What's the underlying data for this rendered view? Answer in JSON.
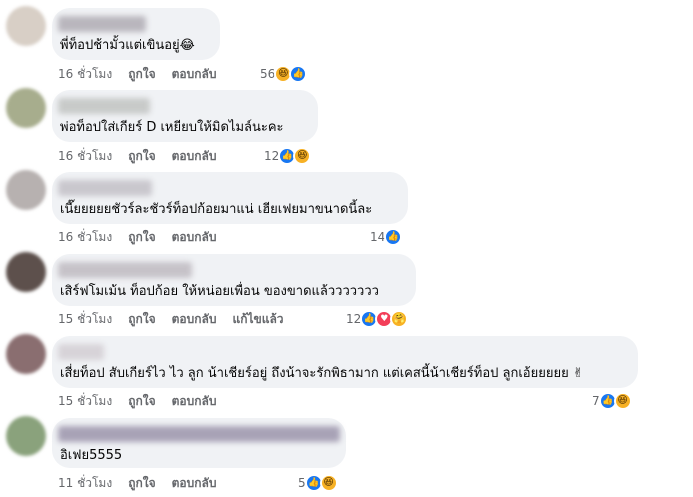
{
  "comments": [
    {
      "text": "พี่ท็อปช้ามั้วแต่เขินอยู่😂",
      "time": "16 ชั่วโมง",
      "like": "ถูกใจ",
      "reply": "ตอบกลับ",
      "edited": "",
      "count": "56",
      "reactions": [
        "haha",
        "like"
      ],
      "colors": {
        "avatar": "#d8cfc6",
        "name": "#b9b6bd"
      }
    },
    {
      "text": "พ่อท็อปใส่เกียร์ D เหยียบให้มิดไมล์นะคะ",
      "time": "16 ชั่วโมง",
      "like": "ถูกใจ",
      "reply": "ตอบกลับ",
      "edited": "",
      "count": "12",
      "reactions": [
        "like",
        "haha"
      ],
      "colors": {
        "avatar": "#a7ad8d",
        "name": "#c8cac9"
      }
    },
    {
      "text": "เนี๊ยยยยยชัวร์ละชัวร์ท็อปก้อยมาแน่ เฮียเฟยมาขนาดนี้ละ",
      "time": "16 ชั่วโมง",
      "like": "ถูกใจ",
      "reply": "ตอบกลับ",
      "edited": "",
      "count": "14",
      "reactions": [
        "like"
      ],
      "colors": {
        "avatar": "#b7b1b0",
        "name": "#c9c7cd"
      }
    },
    {
      "text": "เสิร์ฟโมเม้น ท็อปก้อย ให้หน่อยเพื่อน ของขาดแล้ววววววว",
      "time": "15 ชั่วโมง",
      "like": "ถูกใจ",
      "reply": "ตอบกลับ",
      "edited": "แก้ไขแล้ว",
      "count": "12",
      "reactions": [
        "like",
        "love",
        "care"
      ],
      "colors": {
        "avatar": "#5d504c",
        "name": "#c6c2c8"
      }
    },
    {
      "text": "เสี่ยท็อป สับเกียร์ไว ไว ลูก น้าเชียร์อยู่ ถึงน้าจะรักพิธามาก แต่เคสนี้น้าเชียร์ท็อป ลูกเอ้ยยยยย ✌",
      "time": "15 ชั่วโมง",
      "like": "ถูกใจ",
      "reply": "ตอบกลับ",
      "edited": "",
      "count": "7",
      "reactions": [
        "like",
        "haha"
      ],
      "colors": {
        "avatar": "#8a6e70",
        "name": "#d7d3d8"
      }
    },
    {
      "text": "อิเฟย5555",
      "time": "11 ชั่วโมง",
      "like": "ถูกใจ",
      "reply": "ตอบกลับ",
      "edited": "",
      "count": "5",
      "reactions": [
        "like",
        "haha"
      ],
      "colors": {
        "avatar": "#8aa27c",
        "name": "#a8a2b6"
      }
    }
  ],
  "reaction_glyphs": {
    "like": "👍",
    "love": "♥",
    "haha": "😆",
    "care": "🤗"
  }
}
